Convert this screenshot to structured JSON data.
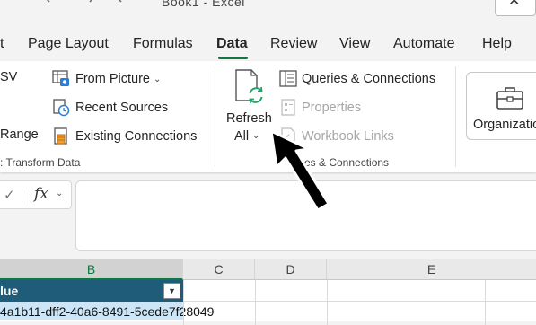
{
  "titlebar": {
    "title": "Book1 - Excel",
    "close_glyph": "✕"
  },
  "tabs": [
    {
      "label": "t"
    },
    {
      "label": "Page Layout"
    },
    {
      "label": "Formulas"
    },
    {
      "label": "Data",
      "active": true
    },
    {
      "label": "Review"
    },
    {
      "label": "View"
    },
    {
      "label": "Automate"
    },
    {
      "label": "Help"
    }
  ],
  "ribbon": {
    "get_transform": {
      "csv_fragment": "SV",
      "range_fragment": "Range",
      "from_picture": "From Picture",
      "recent_sources": "Recent Sources",
      "existing_connections": "Existing Connections",
      "group_label": ": Transform Data"
    },
    "queries": {
      "refresh_all_line1": "Refresh",
      "refresh_all_line2": "All",
      "queries_connections": "Queries & Connections",
      "properties": "Properties",
      "workbook_links": "Workbook Links",
      "group_label": "es & Connections"
    },
    "organization": {
      "label": "Organization"
    }
  },
  "formula_bar": {
    "fx_label": "fx"
  },
  "grid": {
    "columns": [
      "B",
      "C",
      "D",
      "E"
    ],
    "table_header": "lue",
    "first_cell": "4a1b11-dff2-40a6-8491-5cede7f28049"
  },
  "colors": {
    "accent": "#117741",
    "table_header": "#1f5c7a",
    "selected_cell": "#cde6f7"
  }
}
